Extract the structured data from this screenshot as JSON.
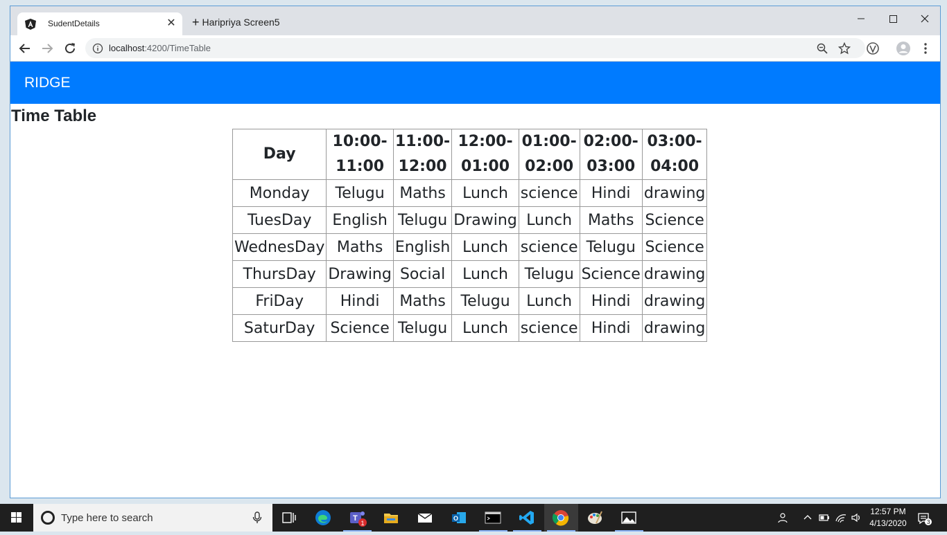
{
  "browser": {
    "active_tab_title": "SudentDetails",
    "new_tab_label": "Haripriya Screen5",
    "url_host": "localhost",
    "url_path": ":4200/TimeTable"
  },
  "app": {
    "brand": "RIDGE",
    "nav_color": "#007bff",
    "page_title": "Time Table"
  },
  "timetable": {
    "headers": [
      "Day",
      "10:00-\n11:00",
      "11:00-\n12:00",
      "12:00-\n01:00",
      "01:00-\n02:00",
      "02:00-\n03:00",
      "03:00-\n04:00"
    ],
    "rows": [
      [
        "Monday",
        "Telugu",
        "Maths",
        "Lunch",
        "science",
        "Hindi",
        "drawing"
      ],
      [
        "TuesDay",
        "English",
        "Telugu",
        "Drawing",
        "Lunch",
        "Maths",
        "Science"
      ],
      [
        "WednesDay",
        "Maths",
        "English",
        "Lunch",
        "science",
        "Telugu",
        "Science"
      ],
      [
        "ThursDay",
        "Drawing",
        "Social",
        "Lunch",
        "Telugu",
        "Science",
        "drawing"
      ],
      [
        "FriDay",
        "Hindi",
        "Maths",
        "Telugu",
        "Lunch",
        "Hindi",
        "drawing"
      ],
      [
        "SaturDay",
        "Science",
        "Telugu",
        "Lunch",
        "science",
        "Hindi",
        "drawing"
      ]
    ]
  },
  "taskbar": {
    "search_placeholder": "Type here to search",
    "time": "12:57 PM",
    "date": "4/13/2020",
    "teams_badge": "1",
    "notification_count": "3"
  }
}
